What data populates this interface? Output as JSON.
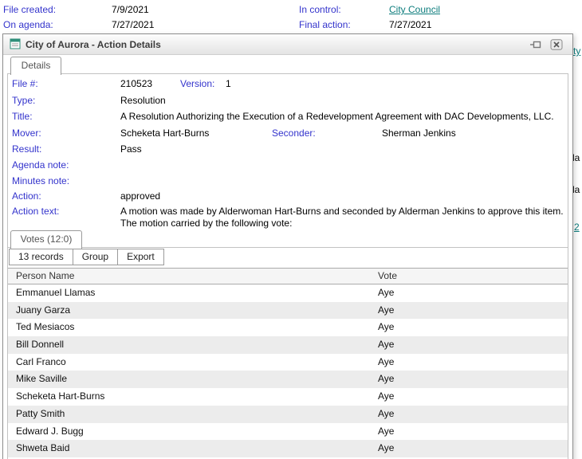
{
  "colors": {
    "label_blue": "#3333cc",
    "link_teal": "#0b7c7c",
    "row_alt": "#ececec"
  },
  "page": {
    "fields": {
      "file_created_label": "File created:",
      "file_created_value": "7/9/2021",
      "on_agenda_label": "On agenda:",
      "on_agenda_value": "7/27/2021",
      "in_control_label": "In control:",
      "in_control_value": "City Council",
      "final_action_label": "Final action:",
      "final_action_value": "7/27/2021"
    },
    "edge_fragments": {
      "f1": "ty",
      "f2": "la",
      "f3": "la",
      "f4": "2"
    }
  },
  "dialog": {
    "title": "City of Aurora - Action Details",
    "tabs": {
      "details": "Details",
      "votes": "Votes (12:0)"
    },
    "fields": {
      "file_label": "File #:",
      "file_value": "210523",
      "version_label": "Version:",
      "version_value": "1",
      "type_label": "Type:",
      "type_value": "Resolution",
      "title_label": "Title:",
      "title_value": "A Resolution Authorizing the Execution of a Redevelopment Agreement with DAC Developments, LLC.",
      "mover_label": "Mover:",
      "mover_value": "Scheketa Hart-Burns",
      "seconder_label": "Seconder:",
      "seconder_value": "Sherman Jenkins",
      "result_label": "Result:",
      "result_value": "Pass",
      "agenda_note_label": "Agenda note:",
      "agenda_note_value": "",
      "minutes_note_label": "Minutes note:",
      "minutes_note_value": "",
      "action_label": "Action:",
      "action_value": "approved",
      "action_text_label": "Action text:",
      "action_text_value": "A motion was made by Alderwoman Hart-Burns and seconded by Alderman Jenkins to approve this item. The motion carried by the following vote:"
    },
    "toolbar": {
      "records": "13 records",
      "group": "Group",
      "export": "Export"
    },
    "table": {
      "headers": [
        "Person Name",
        "Vote"
      ],
      "rows": [
        {
          "name": "Emmanuel Llamas",
          "vote": "Aye"
        },
        {
          "name": "Juany Garza",
          "vote": "Aye"
        },
        {
          "name": "Ted Mesiacos",
          "vote": "Aye"
        },
        {
          "name": "Bill Donnell",
          "vote": "Aye"
        },
        {
          "name": "Carl Franco",
          "vote": "Aye"
        },
        {
          "name": "Mike Saville",
          "vote": "Aye"
        },
        {
          "name": "Scheketa Hart-Burns",
          "vote": "Aye"
        },
        {
          "name": "Patty Smith",
          "vote": "Aye"
        },
        {
          "name": "Edward J. Bugg",
          "vote": "Aye"
        },
        {
          "name": "Shweta Baid",
          "vote": "Aye"
        }
      ]
    }
  }
}
